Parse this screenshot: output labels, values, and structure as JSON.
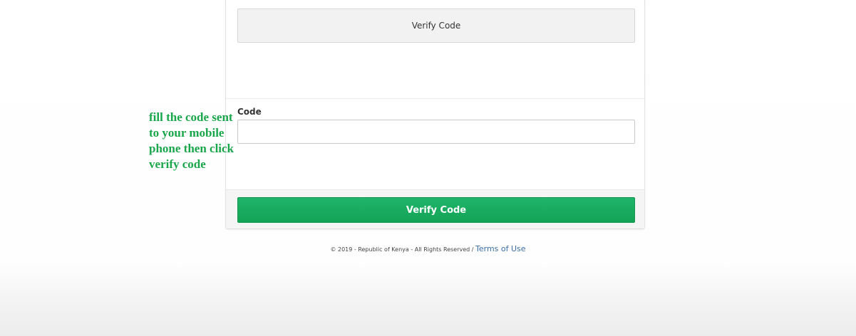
{
  "form": {
    "top_button_label": "Verify Code",
    "code_label": "Code",
    "code_value": "",
    "code_placeholder": "",
    "submit_button_label": "Verify Code"
  },
  "footer": {
    "copyright_text": "© 2019 - Republic of Kenya - All Rights Reserved / ",
    "terms_link_label": "Terms of Use"
  },
  "annotation": {
    "lines": [
      "fill the code sent",
      "to your mobile",
      "phone then click",
      "verify code"
    ],
    "color": "#1aa64a"
  },
  "colors": {
    "primary_button": "#1aa85f",
    "link": "#3b6ea5"
  }
}
